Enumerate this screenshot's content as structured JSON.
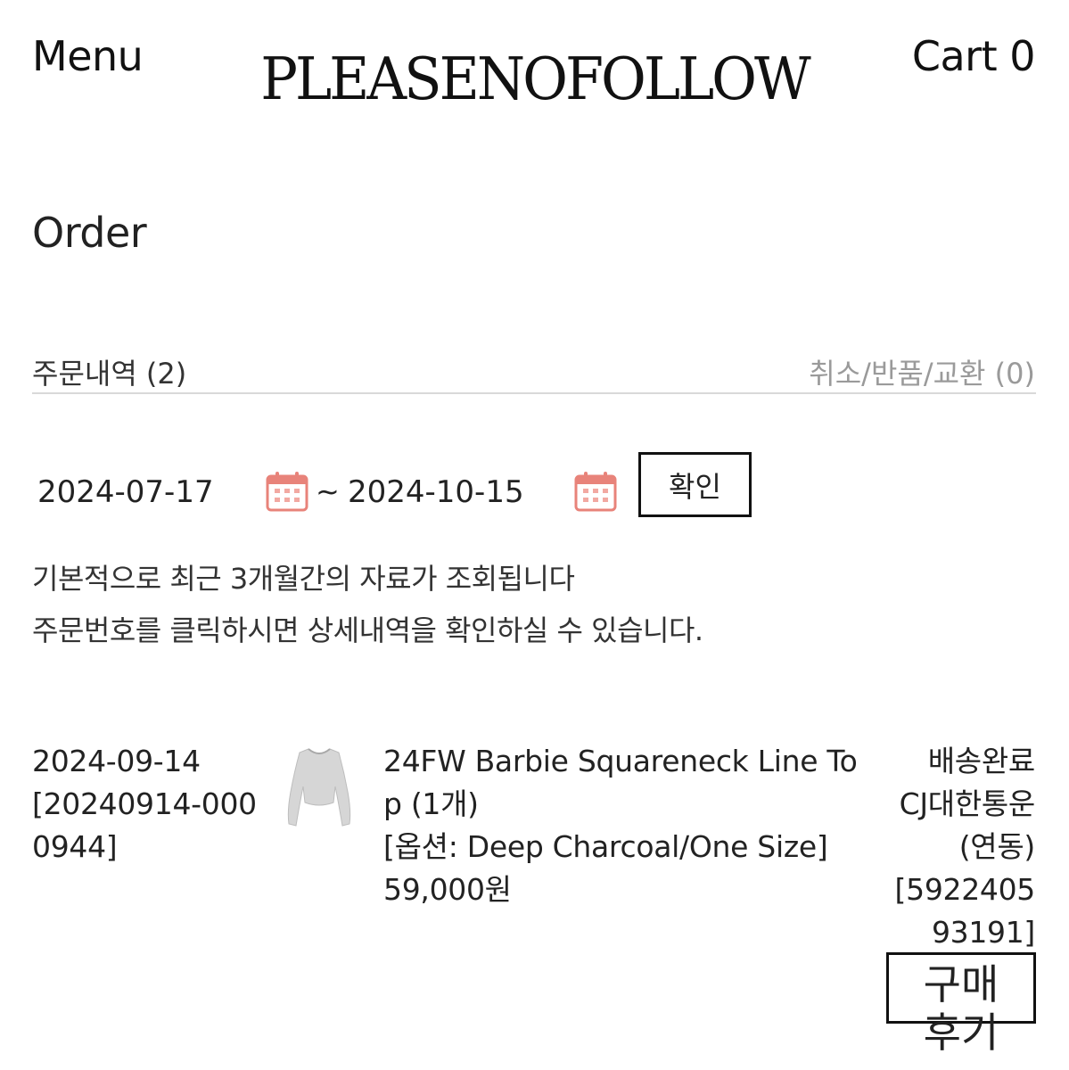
{
  "header": {
    "menu_label": "Menu",
    "logo_text": "PLEASENOFOLLOW",
    "cart_label": "Cart 0"
  },
  "page": {
    "title": "Order"
  },
  "tabs": {
    "orders_label": "주문내역 (2)",
    "cancel_label": "취소/반품/교환 (0)"
  },
  "date_filter": {
    "start": "2024-07-17",
    "separator": "~",
    "end": "2024-10-15",
    "confirm_label": "확인",
    "calendar_color": "#e8837a"
  },
  "notices": {
    "line1": "기본적으로 최근 3개월간의 자료가 조회됩니다",
    "line2": "주문번호를 클릭하시면 상세내역을 확인하실 수 있습니다."
  },
  "orders": [
    {
      "date": "2024-09-14",
      "number": "[20240914-0000944]",
      "product_name": "24FW Barbie Squareneck Line Top (1개)",
      "option": "[옵션: Deep Charcoal/One Size]",
      "price": "59,000원",
      "status": "배송완료",
      "carrier": "CJ대한통운(연동)",
      "tracking": "[592240593191]",
      "review_label": "구매후기"
    }
  ]
}
